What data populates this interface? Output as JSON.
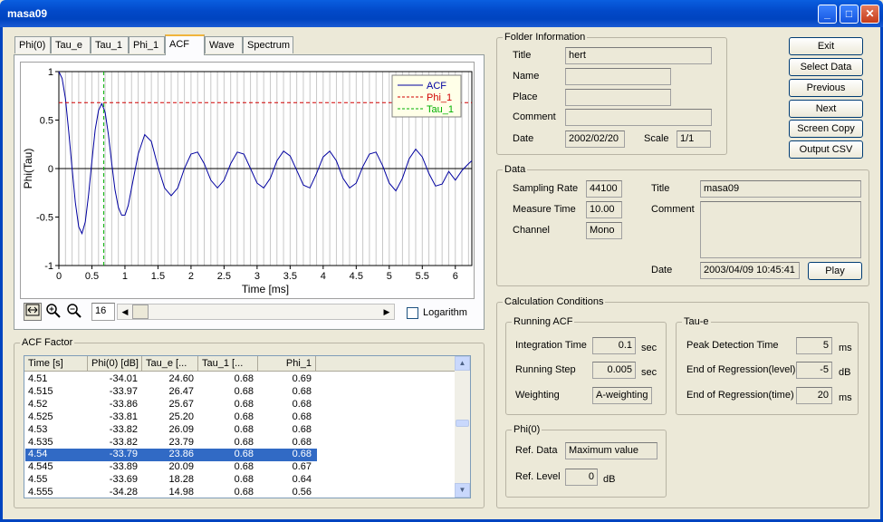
{
  "window": {
    "title": "masa09"
  },
  "tabs": [
    {
      "label": "Phi(0)"
    },
    {
      "label": "Tau_e"
    },
    {
      "label": "Tau_1"
    },
    {
      "label": "Phi_1"
    },
    {
      "label": "ACF"
    },
    {
      "label": "Wave"
    },
    {
      "label": "Spectrum"
    }
  ],
  "selected_tab": "ACF",
  "chart_data": {
    "type": "line",
    "xlabel": "Time [ms]",
    "ylabel": "Phi(Tau)",
    "xlim": [
      0,
      6.25
    ],
    "ylim": [
      -1,
      1
    ],
    "x_ticks": [
      "0",
      "0.5",
      "1",
      "1.5",
      "2",
      "2.5",
      "3",
      "3.5",
      "4",
      "4.5",
      "5",
      "5.5",
      "6"
    ],
    "y_ticks": [
      "1",
      "0.5",
      "0",
      "-0.5",
      "-1"
    ],
    "grid": "vertical",
    "legend": "top-right",
    "series": [
      {
        "name": "ACF",
        "color": "#0000a0",
        "style": "solid",
        "x": [
          0,
          0.05,
          0.1,
          0.15,
          0.2,
          0.25,
          0.3,
          0.35,
          0.4,
          0.45,
          0.5,
          0.55,
          0.6,
          0.65,
          0.7,
          0.75,
          0.8,
          0.85,
          0.9,
          0.95,
          1.0,
          1.05,
          1.1,
          1.2,
          1.3,
          1.4,
          1.5,
          1.6,
          1.7,
          1.8,
          1.9,
          2.0,
          2.1,
          2.2,
          2.3,
          2.4,
          2.5,
          2.6,
          2.7,
          2.8,
          2.9,
          3.0,
          3.1,
          3.2,
          3.3,
          3.4,
          3.5,
          3.6,
          3.7,
          3.8,
          3.9,
          4.0,
          4.1,
          4.2,
          4.3,
          4.4,
          4.5,
          4.6,
          4.7,
          4.8,
          4.9,
          5.0,
          5.1,
          5.2,
          5.3,
          5.4,
          5.5,
          5.6,
          5.7,
          5.8,
          5.9,
          6.0,
          6.1,
          6.2,
          6.25
        ],
        "y": [
          1.0,
          0.93,
          0.72,
          0.38,
          0.0,
          -0.35,
          -0.6,
          -0.67,
          -0.55,
          -0.27,
          0.08,
          0.4,
          0.6,
          0.67,
          0.58,
          0.35,
          0.05,
          -0.22,
          -0.4,
          -0.48,
          -0.48,
          -0.38,
          -0.2,
          0.15,
          0.35,
          0.28,
          0.02,
          -0.2,
          -0.28,
          -0.2,
          0.0,
          0.15,
          0.17,
          0.05,
          -0.12,
          -0.2,
          -0.12,
          0.05,
          0.17,
          0.15,
          0.0,
          -0.15,
          -0.2,
          -0.1,
          0.08,
          0.18,
          0.13,
          -0.02,
          -0.17,
          -0.2,
          -0.05,
          0.12,
          0.18,
          0.08,
          -0.1,
          -0.2,
          -0.15,
          0.02,
          0.15,
          0.17,
          0.03,
          -0.15,
          -0.23,
          -0.1,
          0.1,
          0.2,
          0.12,
          -0.05,
          -0.18,
          -0.16,
          -0.03,
          -0.12,
          -0.02,
          0.05,
          0.08
        ]
      },
      {
        "name": "Phi_1",
        "color": "#d00000",
        "style": "dashed",
        "x": [
          0,
          6.25
        ],
        "y": [
          0.68,
          0.68
        ]
      },
      {
        "name": "Tau_1",
        "color": "#00b000",
        "style": "dashed",
        "x": [
          0.68,
          0.68
        ],
        "y": [
          -1,
          1
        ]
      }
    ]
  },
  "toolbar": {
    "scroll_value": "16",
    "logarithm_label": "Logarithm"
  },
  "acf_factor": {
    "title": "ACF Factor",
    "columns": [
      "Time [s]",
      "Phi(0) [dB]",
      "Tau_e [...",
      "Tau_1 [...",
      "Phi_1"
    ],
    "rows": [
      [
        "4.51",
        "-34.01",
        "24.60",
        "0.68",
        "0.69"
      ],
      [
        "4.515",
        "-33.97",
        "26.47",
        "0.68",
        "0.68"
      ],
      [
        "4.52",
        "-33.86",
        "25.67",
        "0.68",
        "0.68"
      ],
      [
        "4.525",
        "-33.81",
        "25.20",
        "0.68",
        "0.68"
      ],
      [
        "4.53",
        "-33.82",
        "26.09",
        "0.68",
        "0.68"
      ],
      [
        "4.535",
        "-33.82",
        "23.79",
        "0.68",
        "0.68"
      ],
      [
        "4.54",
        "-33.79",
        "23.86",
        "0.68",
        "0.68"
      ],
      [
        "4.545",
        "-33.89",
        "20.09",
        "0.68",
        "0.67"
      ],
      [
        "4.55",
        "-33.69",
        "18.28",
        "0.68",
        "0.64"
      ],
      [
        "4.555",
        "-34.28",
        "14.98",
        "0.68",
        "0.56"
      ]
    ],
    "selected_row": 6
  },
  "folder_info": {
    "title": "Folder Information",
    "title_label": "Title",
    "title_value": "hert",
    "name_label": "Name",
    "name_value": "",
    "place_label": "Place",
    "place_value": "",
    "comment_label": "Comment",
    "comment_value": "",
    "date_label": "Date",
    "date_value": "2002/02/20",
    "scale_label": "Scale",
    "scale_value": "1/1"
  },
  "buttons": {
    "exit": "Exit",
    "select_data": "Select Data",
    "previous": "Previous",
    "next": "Next",
    "screen_copy": "Screen Copy",
    "output_csv": "Output CSV",
    "play": "Play"
  },
  "data": {
    "title": "Data",
    "sampling_rate_label": "Sampling Rate",
    "sampling_rate": "44100",
    "measure_time_label": "Measure Time",
    "measure_time": "10.00",
    "channel_label": "Channel",
    "channel": "Mono",
    "title_label": "Title",
    "title_value": "masa09",
    "comment_label": "Comment",
    "comment_value": "",
    "date_label": "Date",
    "date_value": "2003/04/09 10:45:41"
  },
  "calc": {
    "title": "Calculation Conditions",
    "running_acf": {
      "title": "Running ACF",
      "integration_time_label": "Integration Time",
      "integration_time": "0.1",
      "integration_unit": "sec",
      "running_step_label": "Running Step",
      "running_step": "0.005",
      "running_step_unit": "sec",
      "weighting_label": "Weighting",
      "weighting": "A-weighting"
    },
    "tau_e": {
      "title": "Tau-e",
      "peak_label": "Peak Detection Time",
      "peak": "5",
      "peak_unit": "ms",
      "end_level_label": "End of Regression(level)",
      "end_level": "-5",
      "end_level_unit": "dB",
      "end_time_label": "End of Regression(time)",
      "end_time": "20",
      "end_time_unit": "ms"
    },
    "phi0": {
      "title": "Phi(0)",
      "ref_data_label": "Ref. Data",
      "ref_data": "Maximum value",
      "ref_level_label": "Ref. Level",
      "ref_level": "0",
      "ref_level_unit": "dB"
    }
  }
}
